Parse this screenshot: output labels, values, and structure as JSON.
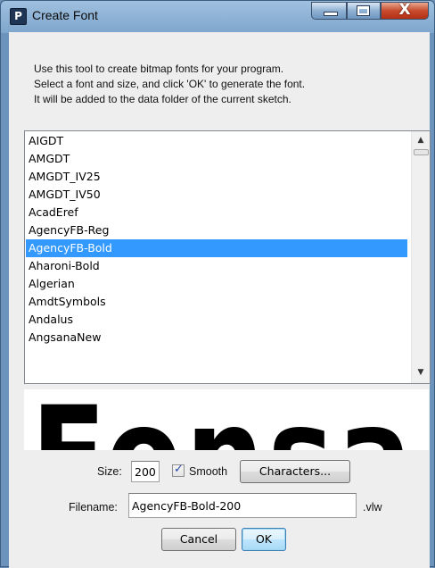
{
  "window": {
    "title": "Create Font",
    "app_icon_glyph": "P",
    "close_glyph": "X"
  },
  "intro": {
    "line1": "Use this tool to create bitmap fonts for your program.",
    "line2": "Select a font and size, and click 'OK' to generate the font.",
    "line3": "It will be added to the data folder of the current sketch."
  },
  "font_list": {
    "items": [
      "AIGDT",
      "AMGDT",
      "AMGDT_IV25",
      "AMGDT_IV50",
      "AcadEref",
      "AgencyFB-Reg",
      "AgencyFB-Bold",
      "Aharoni-Bold",
      "Algerian",
      "AmdtSymbols",
      "Andalus",
      "AngsanaNew"
    ],
    "selected_index": 6,
    "selection_color": "#3399ff"
  },
  "preview": {
    "text": "Fonsa"
  },
  "size": {
    "label": "Size:",
    "value": "200"
  },
  "smooth": {
    "label": "Smooth",
    "checked": true
  },
  "characters_button": "Characters...",
  "filename": {
    "label": "Filename:",
    "value": "AgencyFB-Bold-200",
    "extension": ".vlw"
  },
  "buttons": {
    "cancel": "Cancel",
    "ok": "OK"
  }
}
